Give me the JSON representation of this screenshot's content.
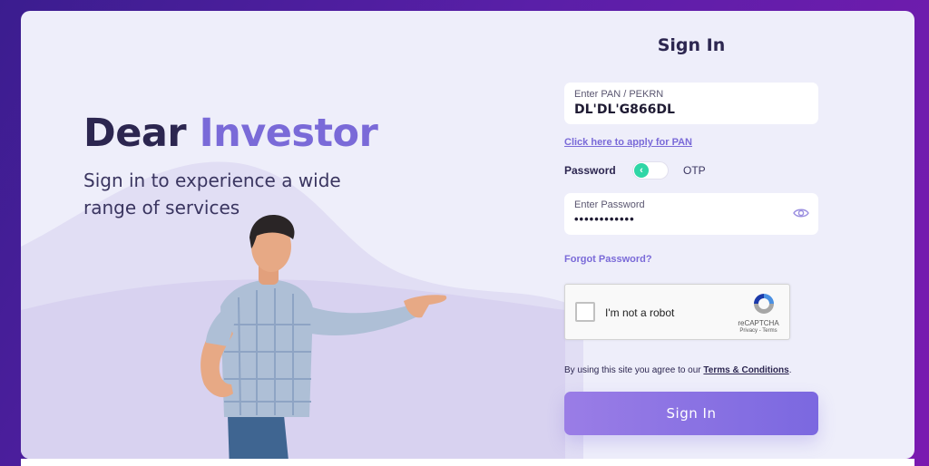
{
  "hero": {
    "title_part1": "Dear",
    "title_part2": "Investor",
    "subtitle": "Sign in to experience a wide range of services"
  },
  "form": {
    "heading": "Sign In",
    "pan_label": "Enter PAN / PEKRN",
    "pan_value": "DL'DL'G866DL",
    "apply_link": "Click here to apply for PAN",
    "toggle_left": "Password",
    "toggle_right": "OTP",
    "toggle_state": "password",
    "password_label": "Enter Password",
    "password_value": "••••••••••••",
    "forgot_link": "Forgot Password?",
    "recaptcha": {
      "label": "I'm not a robot",
      "brand": "reCAPTCHA",
      "links": "Privacy - Terms"
    },
    "agree_prefix": "By using this site you agree to our",
    "agree_link": "Terms & Conditions",
    "agree_suffix": ".",
    "submit_label": "Sign In"
  },
  "colors": {
    "accent": "#7a6ad8",
    "heading_dark": "#2c2650",
    "toggle_on": "#2fd6a6",
    "button_start": "#9a7de6",
    "button_end": "#7b68e0"
  },
  "icons": {
    "eye": "eye-icon",
    "toggle_chevron": "chevron-left-icon",
    "recaptcha_logo": "recaptcha-logo-icon"
  }
}
